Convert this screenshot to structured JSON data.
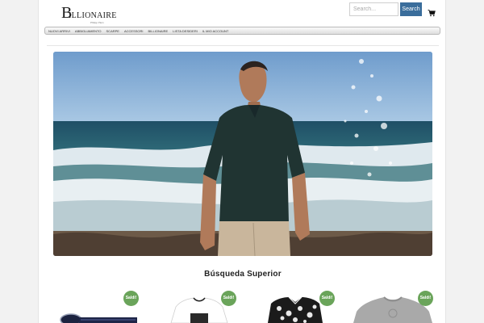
{
  "brand": {
    "initial": "B",
    "name": "ILLIONAIRE",
    "tagline": "Philipp Plein"
  },
  "search": {
    "placeholder": "Search...",
    "button_label": "Search"
  },
  "icons": {
    "cart": "cart-icon"
  },
  "nav": {
    "items": [
      {
        "label": "Nuovi arrivi"
      },
      {
        "label": "Abbigliamento"
      },
      {
        "label": "Scarpe"
      },
      {
        "label": "Accessori"
      },
      {
        "label": "Billionaire"
      },
      {
        "label": "Lista desideri"
      },
      {
        "label": "Il mio account"
      }
    ]
  },
  "hero": {
    "image": "man-in-polo-at-beach"
  },
  "section": {
    "title": "Búsqueda Superior"
  },
  "products": [
    {
      "badge": "Saldi!",
      "image": "navy-belt"
    },
    {
      "badge": "Saldi!",
      "image": "white-tshirt"
    },
    {
      "badge": "Saldi!",
      "image": "black-white-printed-shirt"
    },
    {
      "badge": "Saldi!",
      "image": "grey-sweater"
    }
  ],
  "colors": {
    "accent": "#3a6d9b",
    "sale": "#6aa45a"
  }
}
